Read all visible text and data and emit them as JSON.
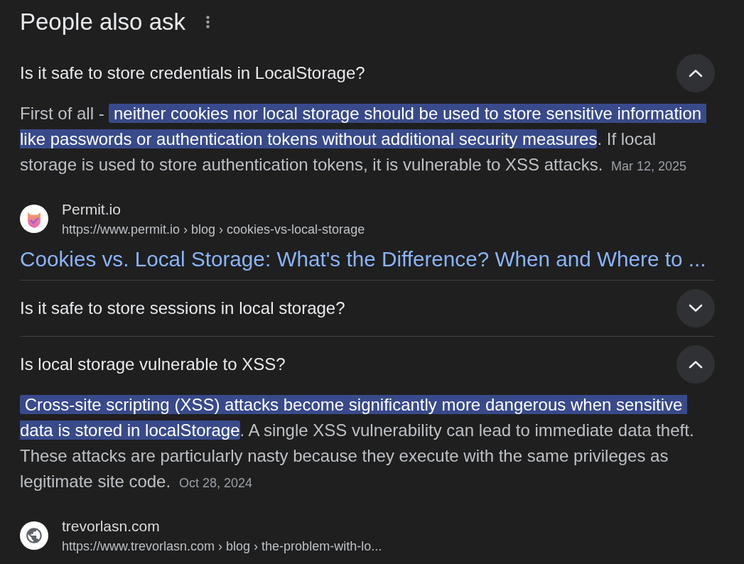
{
  "heading": "People also ask",
  "questions": [
    {
      "question": "Is it safe to store credentials in LocalStorage?",
      "expanded": true,
      "answer": [
        {
          "text": "First of all - ",
          "highlighted": false
        },
        {
          "text": " neither cookies nor local storage should be used to store sensitive information like passwords or authentication tokens without additional security measures",
          "highlighted": true
        },
        {
          "text": ". If local storage is used to store authentication tokens, it is vulnerable to XSS attacks.",
          "highlighted": false
        }
      ],
      "date": "Mar 12, 2025",
      "source": {
        "kind": "logo",
        "name": "Permit.io",
        "url": "https://www.permit.io › blog › cookies-vs-local-storage",
        "title": "Cookies vs. Local Storage: What's the Difference? When and Where to ..."
      }
    },
    {
      "question": "Is it safe to store sessions in local storage?",
      "expanded": false
    },
    {
      "question": "Is local storage vulnerable to XSS?",
      "expanded": true,
      "answer": [
        {
          "text": " Cross-site scripting (XSS) attacks become significantly more dangerous when sensitive data is stored in localStorage",
          "highlighted": true
        },
        {
          "text": ". A single XSS vulnerability can lead to immediate data theft. These attacks are particularly nasty because they execute with the same privileges as legitimate site code.",
          "highlighted": false
        }
      ],
      "date": "Oct 28, 2024",
      "source": {
        "kind": "globe",
        "name": "trevorlasn.com",
        "url": "https://www.trevorlasn.com › blog › the-problem-with-lo..."
      }
    }
  ]
}
